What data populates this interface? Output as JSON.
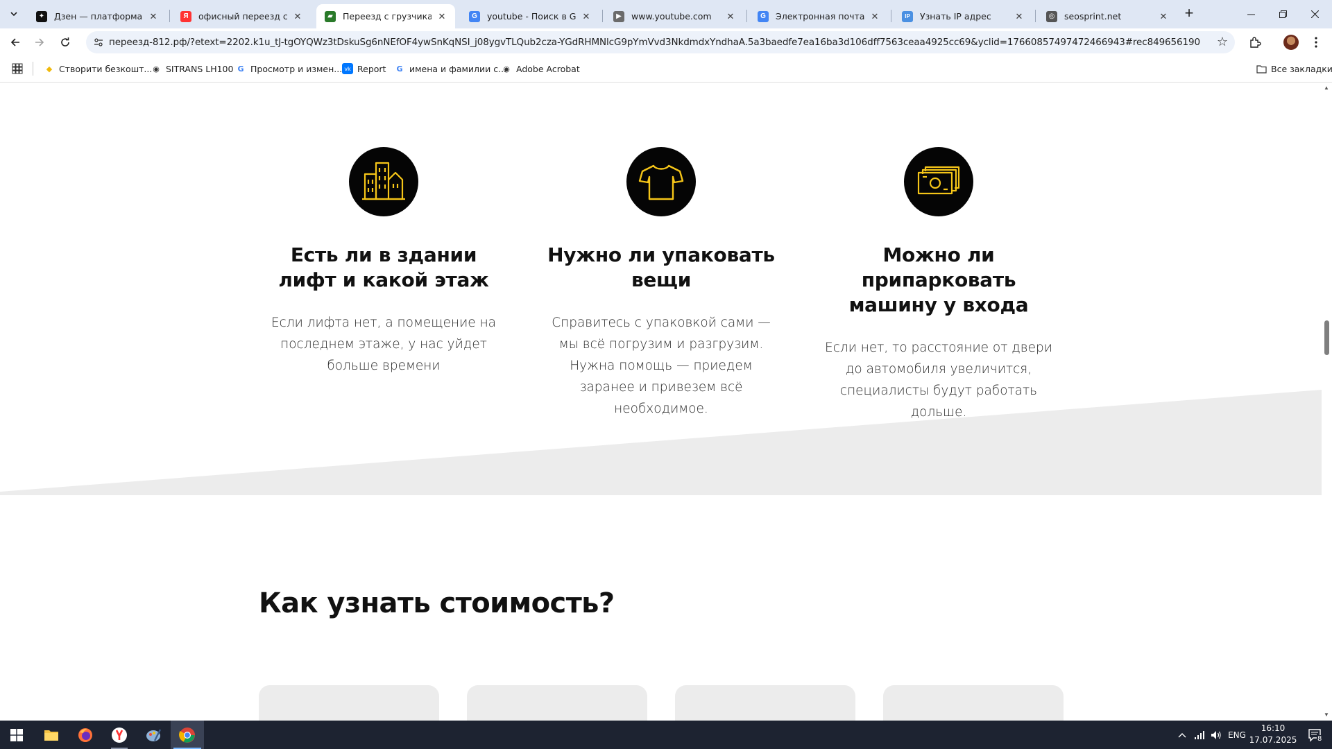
{
  "tabs": [
    {
      "title": "Дзен — платформа для пу",
      "favicon": "zen-icon",
      "favicon_color": "#111111",
      "favicon_glyph": "✦"
    },
    {
      "title": "офисный переезд спб — Я",
      "favicon": "yandex-icon",
      "favicon_color": "#f33",
      "favicon_glyph": "Я"
    },
    {
      "title": "Переезд с грузчиками по",
      "favicon": "truck-icon",
      "favicon_color": "#2a7a2a",
      "favicon_glyph": "▰",
      "active": true
    },
    {
      "title": "youtube - Поиск в Google",
      "favicon": "google-icon",
      "favicon_color": "#4285f4",
      "favicon_glyph": "G"
    },
    {
      "title": "www.youtube.com",
      "favicon": "youtube-icon",
      "favicon_color": "#6b6b6b",
      "favicon_glyph": "▶"
    },
    {
      "title": "Электронная почта Gmail",
      "favicon": "google-icon",
      "favicon_color": "#4285f4",
      "favicon_glyph": "G"
    },
    {
      "title": "Узнать IP адрес",
      "favicon": "ip-icon",
      "favicon_color": "#4a90e2",
      "favicon_glyph": "IP"
    },
    {
      "title": "seosprint.net",
      "favicon": "seosprint-icon",
      "favicon_color": "#555555",
      "favicon_glyph": "◎"
    }
  ],
  "address_bar": {
    "url": "переезд-812.рф/?etext=2202.k1u_tJ-tgOYQWz3tDskuSg6nNEfOF4ywSnKqNSI_j08ygvTLQub2cza-YGdRHMNlcG9pYmVvd3NkdmdxYndhaA.5a3baedfe7ea16ba3d106dff7563ceaa4925cc69&yclid=17660857497472466943#rec849656190"
  },
  "bookmarks": [
    {
      "label": "Створити безкошт...",
      "icon": "binance-icon",
      "color": "#f0b90b",
      "glyph": "◆"
    },
    {
      "label": "SITRANS LH100",
      "icon": "globe-icon",
      "color": "#333333",
      "glyph": "◉"
    },
    {
      "label": "Просмотр и измен...",
      "icon": "google-icon",
      "color": "#4285f4",
      "glyph": "G"
    },
    {
      "label": "Report",
      "icon": "vk-icon",
      "color": "#0077ff",
      "glyph": "vk"
    },
    {
      "label": "имена и фамилии с...",
      "icon": "google-icon",
      "color": "#4285f4",
      "glyph": "G"
    },
    {
      "label": "Adobe Acrobat",
      "icon": "globe-icon",
      "color": "#333333",
      "glyph": "◉"
    }
  ],
  "all_bookmarks_label": "Все закладки",
  "features": [
    {
      "icon": "buildings-icon",
      "title": "Есть ли в здании лифт и какой этаж",
      "text": "Если лифта нет, а помещение на последнем этаже, у нас уйдет больше времени"
    },
    {
      "icon": "tshirt-icon",
      "title": "Нужно ли упаковать вещи",
      "text": "Справитесь с упаковкой сами — мы всё погрузим и разгрузим. Нужна помощь — приедем заранее и привезем всё необходимое."
    },
    {
      "icon": "banknotes-icon",
      "title": "Можно ли припарковать машину у входа",
      "text": "Если нет, то расстояние от двери до автомобиля увеличится, специалисты будут работать дольше."
    }
  ],
  "section_title": "Как узнать стоимость?",
  "colors": {
    "icon_stroke": "#f5c518",
    "icon_bg": "#050505",
    "band": "#ececec"
  },
  "taskbar": {
    "lang": "ENG",
    "time": "16:10",
    "date": "17.07.2025",
    "notifications": "8"
  }
}
